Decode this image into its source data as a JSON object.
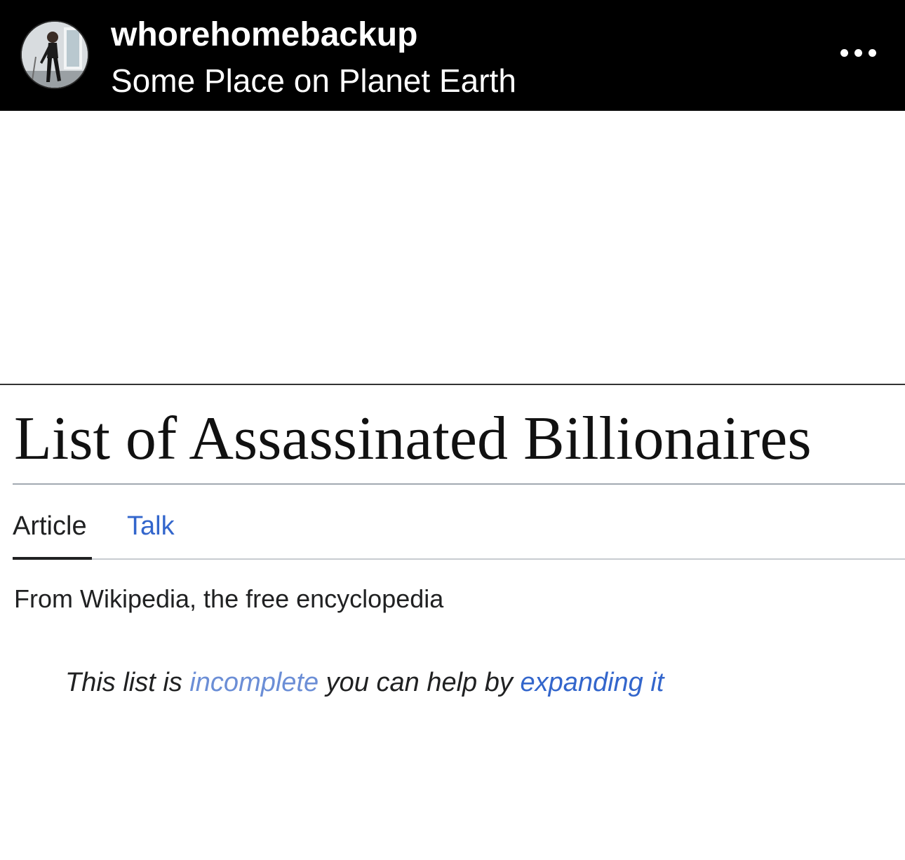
{
  "header": {
    "username": "whorehomebackup",
    "location": "Some Place on Planet Earth",
    "more_icon": "more-horizontal-icon"
  },
  "article": {
    "title": "List of Assassinated Billionaires",
    "tabs": [
      {
        "label": "Article",
        "selected": true
      },
      {
        "label": "Talk",
        "selected": false
      }
    ],
    "tagline": "From Wikipedia, the free encyclopedia",
    "hatnote": {
      "part1": "This list is ",
      "link1": "incomplete",
      "part2": " you can help by ",
      "link2": "expanding it"
    }
  },
  "colors": {
    "header_bg": "#000000",
    "link": "#3366cc",
    "text": "#202122"
  }
}
